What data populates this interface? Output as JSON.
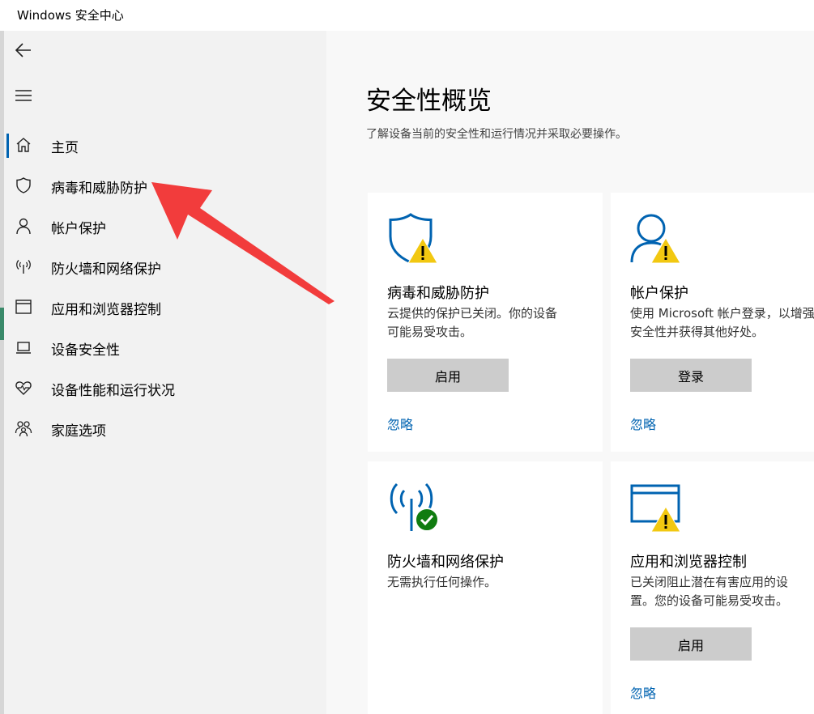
{
  "window": {
    "title": "Windows 安全中心"
  },
  "sidebar": {
    "items": [
      {
        "label": "主页",
        "icon": "home-icon",
        "selected": true
      },
      {
        "label": "病毒和威胁防护",
        "icon": "shield-icon"
      },
      {
        "label": "帐户保护",
        "icon": "person-icon"
      },
      {
        "label": "防火墙和网络保护",
        "icon": "antenna-icon"
      },
      {
        "label": "应用和浏览器控制",
        "icon": "browser-window-icon"
      },
      {
        "label": "设备安全性",
        "icon": "laptop-icon"
      },
      {
        "label": "设备性能和运行状况",
        "icon": "heart-pulse-icon"
      },
      {
        "label": "家庭选项",
        "icon": "family-icon"
      }
    ]
  },
  "main": {
    "title": "安全性概览",
    "subtitle": "了解设备当前的安全性和运行情况并采取必要操作。",
    "cards": [
      {
        "title": "病毒和威胁防护",
        "desc": "云提供的保护已关闭。你的设备\n可能易受攻击。",
        "button": "启用",
        "link": "忽略",
        "status": "warning"
      },
      {
        "title": "帐户保护",
        "desc": "使用 Microsoft 帐户登录，以增强\n安全性并获得其他好处。",
        "button": "登录",
        "link": "忽略",
        "status": "warning"
      },
      {
        "title": "防火墙和网络保护",
        "desc": "无需执行任何操作。",
        "status": "ok"
      },
      {
        "title": "应用和浏览器控制",
        "desc": "已关闭阻止潜在有害应用的设\n置。您的设备可能易受攻击。",
        "button": "启用",
        "link": "忽略",
        "status": "warning"
      }
    ]
  },
  "colors": {
    "accent": "#0063b1",
    "warning": "#f2c811",
    "ok": "#107c10",
    "annotation_arrow": "#f23c3c"
  }
}
